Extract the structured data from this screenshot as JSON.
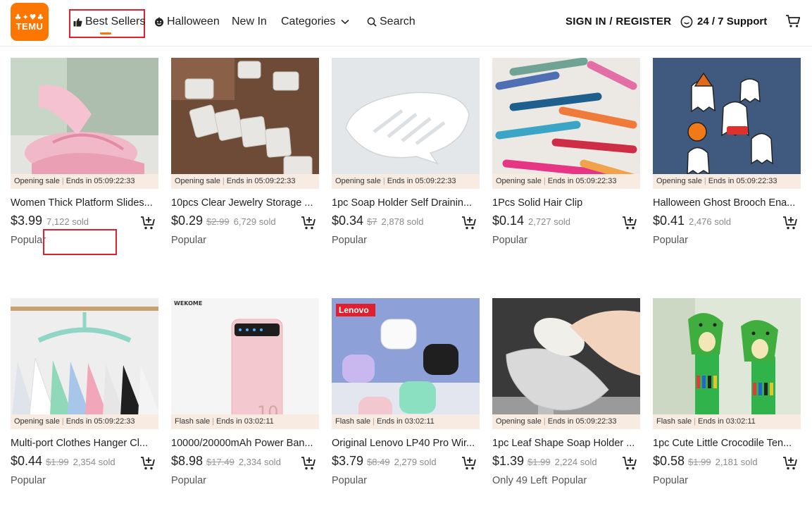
{
  "header": {
    "logo_top": "♣✦♥♣",
    "logo_text": "TEMU",
    "nav": {
      "best_sellers": "Best Sellers",
      "halloween": "Halloween",
      "new_in": "New In",
      "categories": "Categories",
      "search": "Search"
    },
    "signin": "SIGN IN / REGISTER",
    "support": "24 / 7 Support"
  },
  "colors": {
    "brand": "#fb7701",
    "highlight": "#e0202e",
    "sale_strip": "#f8ebe1"
  },
  "products": [
    {
      "title": "Women Thick Platform Slides...",
      "sale_label": "Opening sale",
      "ends": "Ends in 05:09:22:33",
      "price": "$3.99",
      "old_price": "",
      "sold": "7,122 sold",
      "tag": "Popular",
      "left_text": "",
      "image": "pink-slides"
    },
    {
      "title": "10pcs Clear Jewelry Storage ...",
      "sale_label": "Opening sale",
      "ends": "Ends in 05:09:22:33",
      "price": "$0.29",
      "old_price": "$2.99",
      "sold": "6,729 sold",
      "tag": "Popular",
      "left_text": "",
      "image": "clear-boxes"
    },
    {
      "title": "1pc Soap Holder Self Drainin...",
      "sale_label": "Opening sale",
      "ends": "Ends in 05:09:22:33",
      "price": "$0.34",
      "old_price": "$7",
      "sold": "2,878 sold",
      "tag": "Popular",
      "left_text": "",
      "image": "soap-holder-white"
    },
    {
      "title": "1Pcs Solid Hair Clip",
      "sale_label": "Opening sale",
      "ends": "Ends in 05:09:22:33",
      "price": "$0.14",
      "old_price": "",
      "sold": "2,727 sold",
      "tag": "Popular",
      "left_text": "",
      "image": "hair-clips"
    },
    {
      "title": "Halloween Ghost Brooch Ena...",
      "sale_label": "Opening sale",
      "ends": "Ends in 05:09:22:33",
      "price": "$0.41",
      "old_price": "",
      "sold": "2,476 sold",
      "tag": "Popular",
      "left_text": "",
      "image": "ghost-brooch"
    },
    {
      "title": "Multi-port Clothes Hanger Cl...",
      "sale_label": "Opening sale",
      "ends": "Ends in 05:09:22:33",
      "price": "$0.44",
      "old_price": "$1.99",
      "sold": "2,354 sold",
      "tag": "Popular",
      "left_text": "",
      "image": "clothes-hanger"
    },
    {
      "title": "10000/20000mAh Power Ban...",
      "sale_label": "Flash sale",
      "ends": "Ends in 03:02:11",
      "price": "$8.98",
      "old_price": "$17.49",
      "sold": "2,334 sold",
      "tag": "Popular",
      "left_text": "",
      "image": "power-bank",
      "brand_mark": "WEKOME",
      "bank_number": "10"
    },
    {
      "title": "Original Lenovo LP40 Pro Wir...",
      "sale_label": "Flash sale",
      "ends": "Ends in 03:02:11",
      "price": "$3.79",
      "old_price": "$8.49",
      "sold": "2,279 sold",
      "tag": "Popular",
      "left_text": "",
      "image": "earbuds",
      "brand_mark": "Lenovo"
    },
    {
      "title": "1pc Leaf Shape Soap Holder ...",
      "sale_label": "Opening sale",
      "ends": "Ends in 05:09:22:33",
      "price": "$1.39",
      "old_price": "$1.99",
      "sold": "2,224 sold",
      "tag": "Popular",
      "left_text": "Only 49 Left",
      "image": "leaf-soap-holder"
    },
    {
      "title": "1pc Cute Little Crocodile Ten...",
      "sale_label": "Flash sale",
      "ends": "Ends in 03:02:11",
      "price": "$0.58",
      "old_price": "$1.99",
      "sold": "2,181 sold",
      "tag": "Popular",
      "left_text": "",
      "image": "crocodile-pens"
    }
  ]
}
